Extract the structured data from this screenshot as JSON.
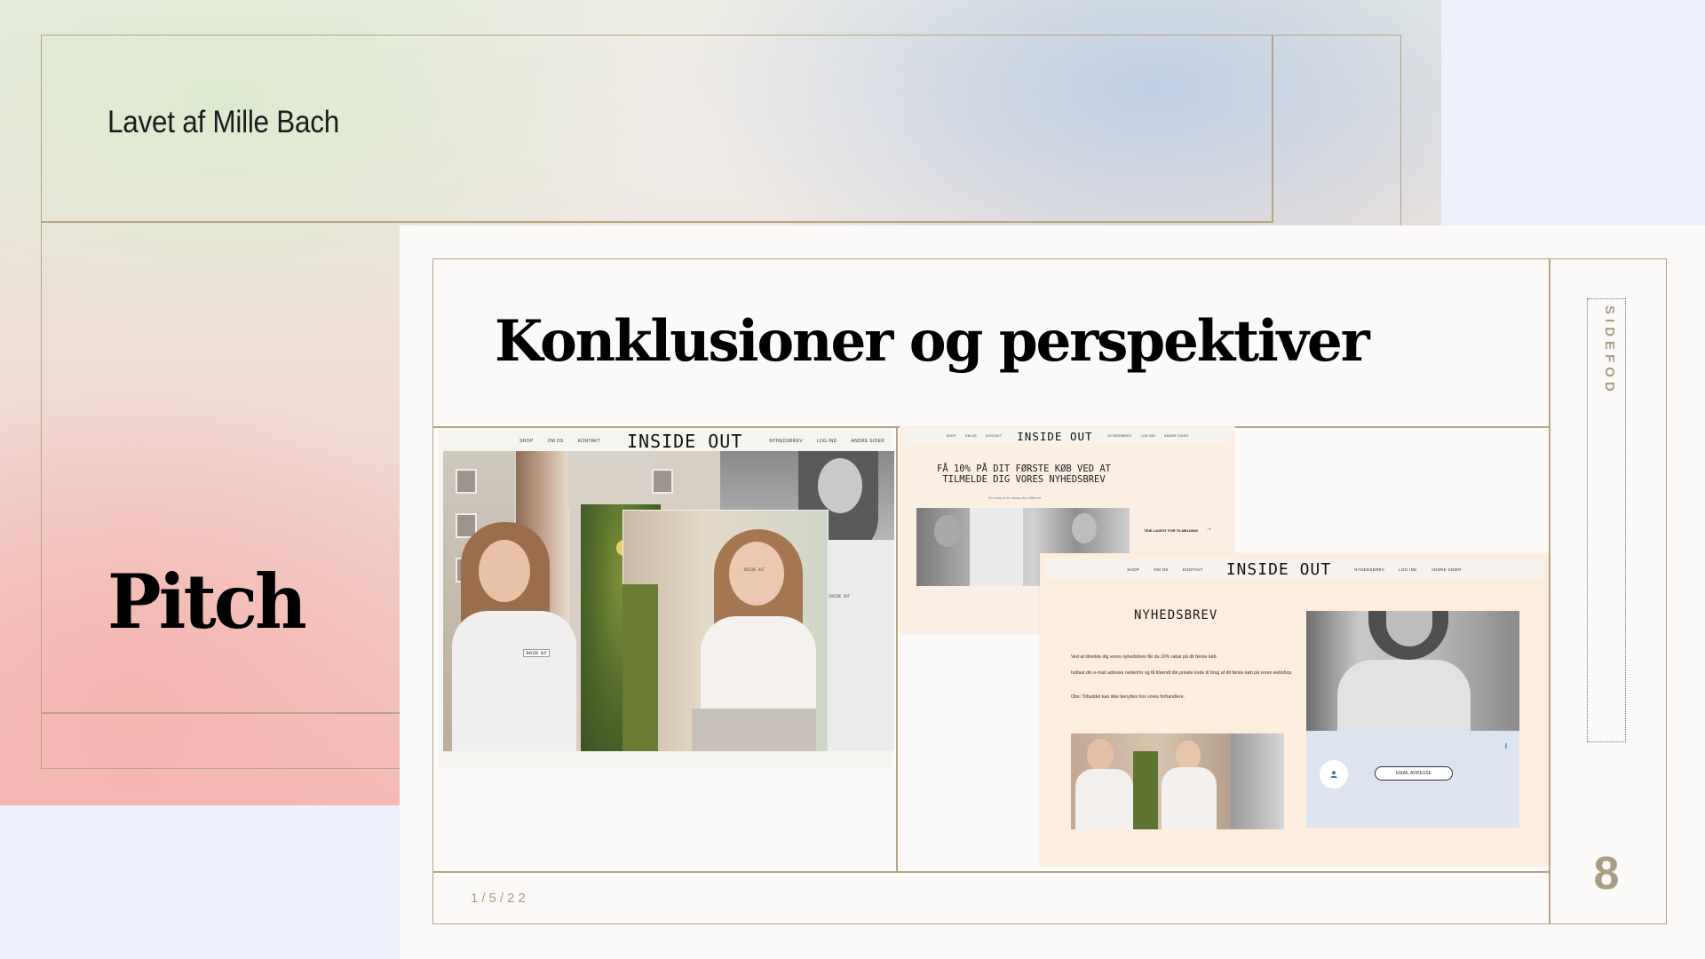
{
  "background_slide": {
    "author": "Lavet af Mille Bach",
    "title": "Pitch"
  },
  "slide": {
    "title": "Konklusioner og perspektiver",
    "footer_placeholder": "SIDEFOD",
    "date": "1/5/22",
    "page_number": "8"
  },
  "website": {
    "brand": "INSIDE OUT",
    "nav_left": [
      "SHOP",
      "OM OS",
      "KONTAKT"
    ],
    "nav_right": [
      "NYHEDSBREV",
      "LOG IND",
      "ANDRE SIDER"
    ],
    "tshirt_label": "INSIDE OUT",
    "offer_text": "FÅ 10% PÅ DIT FØRSTE KØB VED AT TILMELDE DIG VORES NYHEDSBREV",
    "offer_subtext": "It's easy to be classy but different",
    "signup_link": "TRÆ LAVEST FOR TILMELDING",
    "newsletter_heading": "NYHEDSBREV",
    "newsletter_paragraphs": [
      "Ved at tilmelde dig vores nyhedsbrev får du 10% rabat på dit første køb.",
      "Indtast din e-mail adresse nedenfor og få tilsendt din private kode til brug af dit første køb på vores webshop.",
      "Obs: Tilbuddet kan ikke benyttes hos vores forhandlere."
    ],
    "email_placeholder": "EMAIL ADRESSE"
  },
  "colors": {
    "accent_gold": "#b6a583",
    "muted_text": "#a89e84",
    "slide_bg": "#fbfaf8",
    "site_peach": "#fcedde",
    "form_blue": "#dde4ef"
  },
  "icons": [
    "user-icon",
    "arrow-right-icon"
  ]
}
